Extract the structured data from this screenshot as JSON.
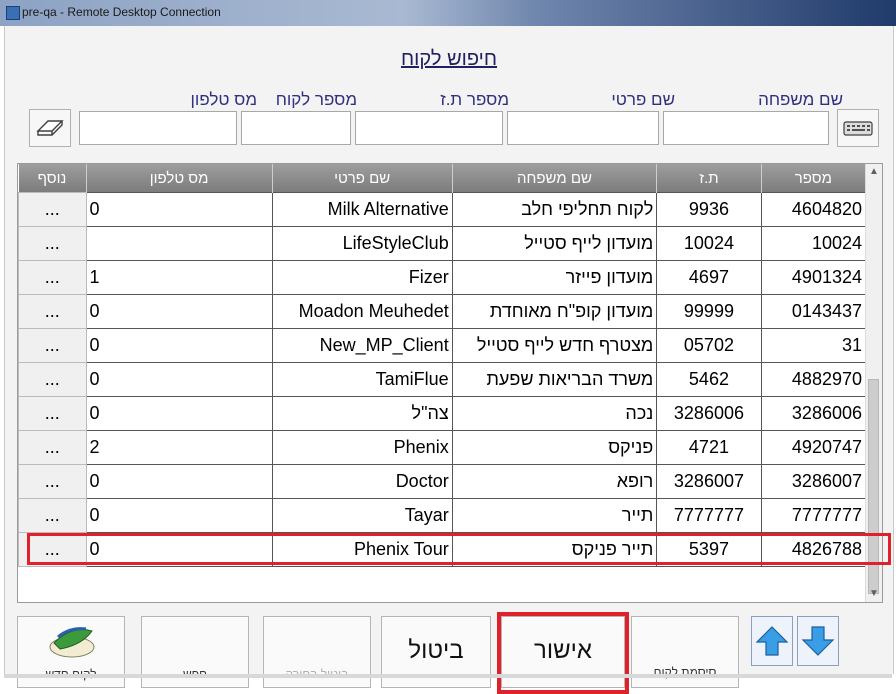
{
  "window": {
    "title": "pre-qa - Remote Desktop Connection"
  },
  "dialog": {
    "title": "חיפוש לקוח"
  },
  "search": {
    "labels": {
      "last_name": "שם משפחה",
      "first_name": "שם פרטי",
      "id": "מספר ת.ז",
      "customer_no": "מספר לקוח",
      "phone": "מס טלפון"
    },
    "values": {
      "last_name": "",
      "first_name": "",
      "id": "",
      "customer_no": "",
      "phone": ""
    }
  },
  "icons": {
    "eraser": "eraser-icon",
    "keyboard": "keyboard-icon",
    "up": "arrow-up-icon",
    "down": "arrow-down-icon",
    "new_customer": "new-customer-icon"
  },
  "table": {
    "headers": {
      "number": "מספר",
      "id": "ת.ז",
      "last": "שם משפחה",
      "first": "שם פרטי",
      "phone": "מס טלפון",
      "more": "נוסף"
    },
    "rows": [
      {
        "number": "4604820",
        "id": "9936",
        "last": "לקוח תחליפי חלב",
        "first": "Milk Alternative",
        "phone": "0",
        "more": "..."
      },
      {
        "number": "10024",
        "id": "10024",
        "last": "מועדון לייף סטייל",
        "first": "LifeStyleClub",
        "phone": "",
        "more": "..."
      },
      {
        "number": "4901324",
        "id": "4697",
        "last": "מועדון פייזר",
        "first": "Fizer",
        "phone": "1",
        "more": "..."
      },
      {
        "number": "0143437",
        "id": "99999",
        "last": "מועדון קופ\"ח מאוחדת",
        "first": "Moadon Meuhedet",
        "phone": "0",
        "more": "..."
      },
      {
        "number": "31",
        "id": "05702",
        "last": "מצטרף חדש לייף סטייל",
        "first": "New_MP_Client",
        "phone": "0",
        "more": "..."
      },
      {
        "number": "4882970",
        "id": "5462",
        "last": "משרד הבריאות שפעת",
        "first": "TamiFlue",
        "phone": "0",
        "more": "..."
      },
      {
        "number": "3286006",
        "id": "3286006",
        "last": "נכה",
        "first": "צה\"ל",
        "phone": "0",
        "more": "..."
      },
      {
        "number": "4920747",
        "id": "4721",
        "last": "פניקס",
        "first": "Phenix",
        "phone": "2",
        "more": "..."
      },
      {
        "number": "3286007",
        "id": "3286007",
        "last": "רופא",
        "first": "Doctor",
        "phone": "0",
        "more": "..."
      },
      {
        "number": "7777777",
        "id": "7777777",
        "last": "תייר",
        "first": "Tayar",
        "phone": "0",
        "more": "..."
      },
      {
        "number": "4826788",
        "id": "5397",
        "last": "תייר פניקס",
        "first": "Phenix Tour",
        "phone": "0",
        "more": "..."
      }
    ]
  },
  "buttons": {
    "new_customer": "לקוח חדש",
    "search": "חפש",
    "cancel_selection": "ביטול בחירה",
    "cancel": "ביטול",
    "confirm": "אישור",
    "customer_password": "סיסמת לקוח"
  },
  "colors": {
    "highlight": "#e0202a",
    "header_bg": "#8a8a8a",
    "title_text": "#202060"
  }
}
